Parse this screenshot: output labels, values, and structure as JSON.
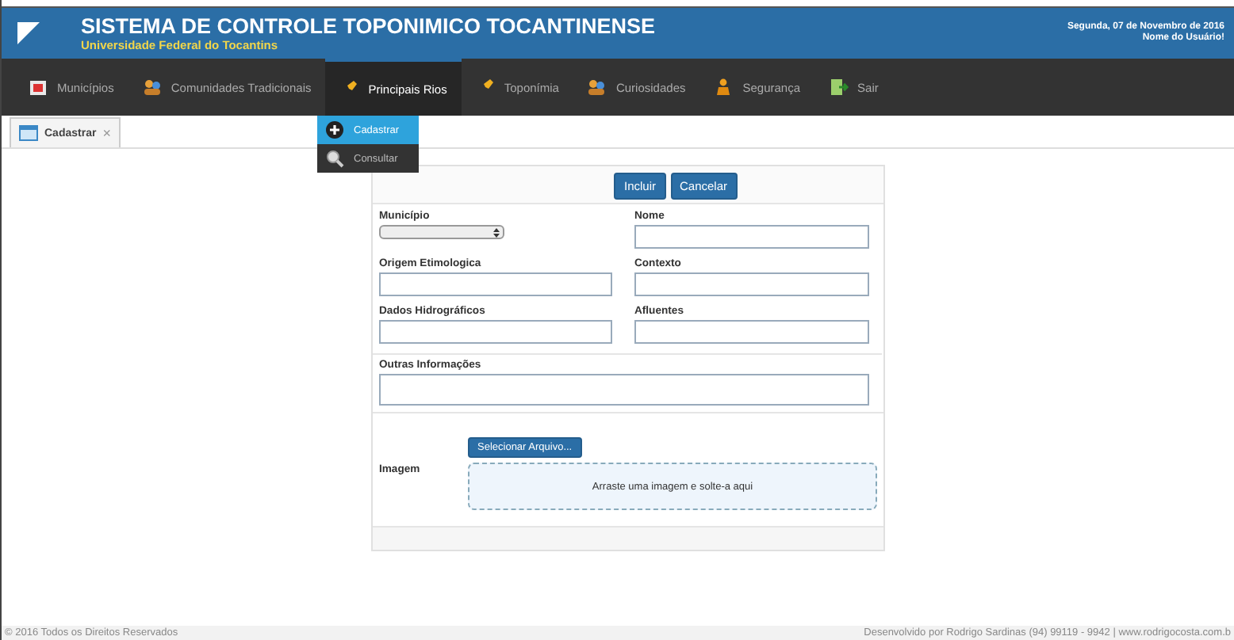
{
  "header": {
    "title": "SISTEMA DE CONTROLE TOPONIMICO TOCANTINENSE",
    "subtitle": "Universidade Federal do Tocantins",
    "date": "Segunda, 07 de Novembro de 2016",
    "user": "Nome do Usuário!"
  },
  "nav": [
    {
      "label": "Municípios",
      "kind": "calendar",
      "selected": false
    },
    {
      "label": "Comunidades Tradicionais",
      "kind": "people",
      "selected": false
    },
    {
      "label": "Principais Rios",
      "kind": "pin",
      "selected": true
    },
    {
      "label": "Toponímia",
      "kind": "pin",
      "selected": false
    },
    {
      "label": "Curiosidades",
      "kind": "people",
      "selected": false
    },
    {
      "label": "Segurança",
      "kind": "person",
      "selected": false
    },
    {
      "label": "Sair",
      "kind": "exit",
      "selected": false
    }
  ],
  "dropdown": [
    {
      "label": "Cadastrar",
      "kind": "plus",
      "selected": true
    },
    {
      "label": "Consultar",
      "kind": "search",
      "selected": false
    }
  ],
  "tabs": [
    {
      "label": "Cadastrar",
      "close": "×"
    }
  ],
  "form": {
    "buttons": [
      "Incluir",
      "Cancelar"
    ],
    "fields": [
      {
        "label": "Município",
        "kind": "select"
      },
      {
        "label": "Nome",
        "kind": "text"
      },
      {
        "label": "Origem Etimologica",
        "kind": "text"
      },
      {
        "label": "Contexto",
        "kind": "text"
      },
      {
        "label": "Dados Hidrográficos",
        "kind": "text"
      },
      {
        "label": "Afluentes",
        "kind": "text"
      },
      {
        "label": "Outras Informações",
        "kind": "textarea"
      }
    ],
    "image": {
      "label": "Imagem",
      "button": "Selecionar Arquivo...",
      "dropzone": "Arraste uma imagem e solte-a aqui"
    }
  },
  "footer": {
    "left": "© 2016 Todos os Direitos Reservados",
    "right": "Desenvolvido por Rodrigo Sardinas (94) 99119 - 9942 | www.rodrigocosta.com.b"
  }
}
